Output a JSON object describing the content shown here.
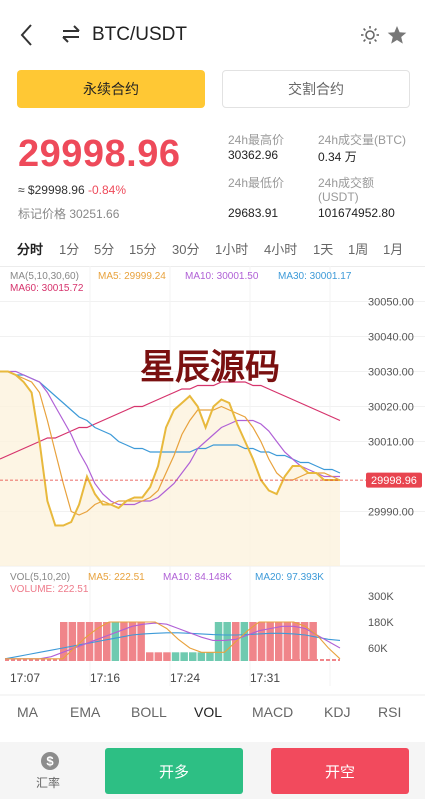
{
  "header": {
    "pair": "BTC/USDT"
  },
  "tabs": {
    "perpetual": "永续合约",
    "delivery": "交割合约"
  },
  "ticker": {
    "price": "29998.96",
    "approx_prefix": "≈ $29998.96",
    "change": "-0.84%",
    "mark_price": "标记价格 30251.66",
    "high_label": "24h最高价",
    "high_value": "30362.96",
    "low_label": "24h最低价",
    "low_value": "29683.91",
    "vol_btc_label": "24h成交量(BTC)",
    "vol_btc_value": "0.34 万",
    "vol_usdt_label_1": "24h成交额",
    "vol_usdt_label_2": "(USDT)",
    "vol_usdt_value": "101674952.80"
  },
  "periods": [
    "分时",
    "1分",
    "5分",
    "15分",
    "30分",
    "1小时",
    "4小时",
    "1天",
    "1周",
    "1月"
  ],
  "indicators": [
    "MA",
    "EMA",
    "BOLL",
    "VOL",
    "MACD",
    "KDJ",
    "RSI"
  ],
  "bottom": {
    "rate": "汇率",
    "long": "开多",
    "short": "开空"
  },
  "colors": {
    "accent": "#ffc834",
    "up": "#2dbf84",
    "down": "#f24a5d",
    "price": "#ee4a5a"
  },
  "chart_data": {
    "type": "line",
    "watermark": "星辰源码",
    "ma_header": "MA(5,10,30,60)",
    "ma_labels": {
      "ma5": "MA5: 29999.24",
      "ma10": "MA10: 30001.50",
      "ma30": "MA30: 30001.17",
      "ma60": "MA60: 30015.72"
    },
    "price_axis": [
      "30050.00",
      "30040.00",
      "30030.00",
      "30020.00",
      "30010.00",
      "29990.00"
    ],
    "ylim": [
      29983,
      30055
    ],
    "current_price": 29998.96,
    "current_price_label": "29998.96",
    "n_points": 44,
    "price": [
      30030,
      30030,
      30029,
      30027,
      30024,
      30010,
      29993,
      29986,
      29986,
      29987,
      29992,
      30000,
      29995,
      29992,
      29992,
      29991,
      29993,
      29994,
      29994,
      29997,
      30003,
      30014,
      30019,
      30021,
      30023,
      30020,
      30014,
      30020,
      30022,
      30021,
      30015,
      30010,
      30005,
      29999,
      29996,
      29995,
      30000,
      30003,
      30003,
      30001,
      30001,
      29999,
      29999,
      29999
    ],
    "ma5": [
      30030,
      30030,
      30029,
      30028,
      30027,
      30024,
      30016,
      30007,
      29998,
      29990,
      29989,
      29990,
      29992,
      29993,
      29992,
      29993,
      29993,
      29993,
      29993,
      29994,
      29996,
      30001,
      30006,
      30012,
      30016,
      30019,
      30019,
      30019,
      30020,
      30019,
      30018,
      30017,
      30014,
      30010,
      30005,
      30001,
      29999,
      29999,
      30000,
      30001,
      30001,
      30001,
      30000,
      29999
    ],
    "ma10": [
      30030,
      30030,
      30030,
      30029,
      30028,
      30027,
      30024,
      30020,
      30016,
      30012,
      30007,
      30003,
      29998,
      29995,
      29993,
      29992,
      29992,
      29992,
      29993,
      29993,
      29994,
      29996,
      29998,
      30001,
      30004,
      30008,
      30010,
      30012,
      30014,
      30015,
      30016,
      30016,
      30016,
      30015,
      30013,
      30010,
      30007,
      30005,
      30003,
      30002,
      30001,
      30000,
      30000,
      30000
    ],
    "ma30": [
      30030,
      30030,
      30029,
      30029,
      30028,
      30027,
      30025,
      30023,
      30021,
      30019,
      30017,
      30016,
      30014,
      30013,
      30012,
      30010,
      30009,
      30008,
      30008,
      30007,
      30007,
      30007,
      30007,
      30007,
      30007,
      30008,
      30008,
      30009,
      30009,
      30009,
      30009,
      30008,
      30008,
      30007,
      30007,
      30006,
      30006,
      30005,
      30004,
      30004,
      30003,
      30002,
      30002,
      30001
    ],
    "ma60": [
      30005,
      30006,
      30007,
      30008,
      30009,
      30010,
      30011,
      30011,
      30012,
      30013,
      30014,
      30014,
      30015,
      30016,
      30017,
      30018,
      30019,
      30020,
      30020,
      30021,
      30022,
      30023,
      30024,
      30025,
      30025,
      30026,
      30026,
      30026,
      30027,
      30027,
      30027,
      30027,
      30026,
      30026,
      30025,
      30024,
      30023,
      30022,
      30021,
      30020,
      30019,
      30018,
      30017,
      30016
    ],
    "vol_header": "VOL(5,10,20)",
    "vol_labels": {
      "ma5": "MA5: 222.51",
      "ma10": "MA10: 84.148K",
      "ma20": "MA20: 97.393K",
      "volume": "VOLUME: 222.51"
    },
    "vol_axis": [
      "300K",
      "180K",
      "60K"
    ],
    "vol_ylim": [
      0,
      300
    ],
    "vol_bars": [
      {
        "i": 17,
        "v": 180,
        "up": false
      },
      {
        "i": 18,
        "v": 180,
        "up": false
      },
      {
        "i": 19,
        "v": 180,
        "up": false
      },
      {
        "i": 20,
        "v": 180,
        "up": false
      },
      {
        "i": 21,
        "v": 180,
        "up": false
      },
      {
        "i": 22,
        "v": 180,
        "up": false
      },
      {
        "i": 23,
        "v": 180,
        "up": true
      },
      {
        "i": 24,
        "v": 180,
        "up": false
      },
      {
        "i": 25,
        "v": 180,
        "up": false
      },
      {
        "i": 26,
        "v": 180,
        "up": false
      },
      {
        "i": 27,
        "v": 40,
        "up": false
      },
      {
        "i": 28,
        "v": 40,
        "up": false
      },
      {
        "i": 29,
        "v": 40,
        "up": false
      },
      {
        "i": 30,
        "v": 40,
        "up": true
      },
      {
        "i": 31,
        "v": 40,
        "up": true
      },
      {
        "i": 32,
        "v": 40,
        "up": true
      },
      {
        "i": 33,
        "v": 40,
        "up": true
      },
      {
        "i": 34,
        "v": 40,
        "up": true
      },
      {
        "i": 35,
        "v": 180,
        "up": true
      },
      {
        "i": 36,
        "v": 180,
        "up": true
      },
      {
        "i": 37,
        "v": 180,
        "up": false
      },
      {
        "i": 38,
        "v": 180,
        "up": true
      },
      {
        "i": 39,
        "v": 180,
        "up": false
      },
      {
        "i": 40,
        "v": 180,
        "up": false
      },
      {
        "i": 41,
        "v": 180,
        "up": false
      },
      {
        "i": 42,
        "v": 180,
        "up": false
      },
      {
        "i": 43,
        "v": 180,
        "up": false
      },
      {
        "i": 44,
        "v": 180,
        "up": false
      },
      {
        "i": 45,
        "v": 180,
        "up": false
      },
      {
        "i": 46,
        "v": 180,
        "up": false
      }
    ],
    "vol_ma5": [
      10,
      10,
      10,
      10,
      10,
      10,
      60,
      110,
      150,
      180,
      180,
      180,
      180,
      180,
      150,
      100,
      60,
      40,
      40,
      40,
      90,
      140,
      180,
      180,
      180,
      180,
      160,
      120,
      60,
      10
    ],
    "vol_ma10": [
      10,
      10,
      10,
      10,
      20,
      40,
      60,
      80,
      100,
      120,
      140,
      160,
      170,
      175,
      170,
      150,
      130,
      110,
      95,
      95,
      100,
      120,
      140,
      150,
      160,
      160,
      150,
      120,
      90,
      60
    ],
    "vol_ma20": [
      10,
      20,
      30,
      40,
      50,
      60,
      70,
      80,
      90,
      100,
      110,
      120,
      125,
      128,
      130,
      130,
      128,
      125,
      122,
      120,
      120,
      122,
      125,
      128,
      128,
      125,
      120,
      110,
      100,
      95
    ],
    "time_labels": [
      "17:07",
      "17:16",
      "17:24",
      "17:31"
    ]
  }
}
